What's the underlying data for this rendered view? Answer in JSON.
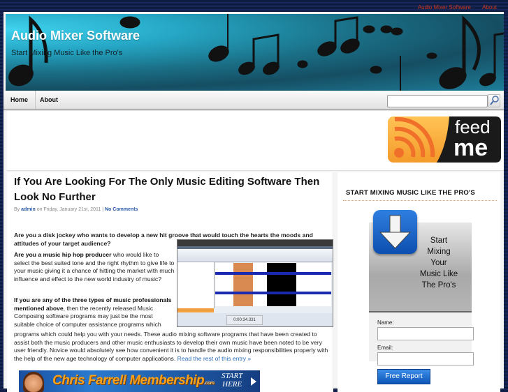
{
  "top_links": [
    "Audio Mixer Software",
    "About"
  ],
  "header": {
    "title": "Audio Mixer Software",
    "tagline": "Start Mixing Music Like the Pro's"
  },
  "nav": {
    "items": [
      "Home",
      "About"
    ],
    "search_value": "",
    "search_icon": "magnifier-icon"
  },
  "feed_badge": {
    "line1": "feed",
    "line2": "me",
    "icon": "rss-icon"
  },
  "post": {
    "title": "If You Are Looking For The Only Music Editing Software Then Look No Further",
    "meta_by": "By ",
    "author": "admin",
    "meta_on": " on Friday, January 21st, 2011 | ",
    "comments": "No Comments",
    "p1": "Are you  a disk jockey who wants to develop a new hit groove that would touch the hearts the moods and attitudes of your target audience?",
    "p2_bold": "Are you a music hip hop producer",
    "p2_rest": " who would like to select the best suited tone and the right rhythm to give life to your music giving it a chance of hitting the market with much influence and effect to the new world industry of music?",
    "p3_bold": " If you are any of the three types of music professionals mentioned above",
    "p3_rest": ", then the recently released Music Composing software programs may just be the most suitable choice of computer assistance programs which could help you with your needs. These audio mixing software programs that have been created to assist both the music producers and other music enthusiasts to develop their own music have been noted to be very user friendly. Novice would absolutely see how convenient it is to handle the audio mixing responsibilities properly with the help of the new age technology of computer applications.",
    "read_more": "Read the rest of this entry »",
    "screenshot_time": "0:00:34.331"
  },
  "banner": {
    "text": "Chris Farrell Membership",
    "com": ".com",
    "cta_line1": "START",
    "cta_line2": "HERE"
  },
  "sidebar": {
    "widget_title": "START MIXING MUSIC LIKE THE PRO'S",
    "optin_lines": [
      "Start",
      "Mixing",
      "Your",
      "Music Like",
      "The Pro's"
    ],
    "name_label": "Name:",
    "name_value": "",
    "email_label": "Email:",
    "email_value": "",
    "button": "Free Report"
  },
  "colors": {
    "accent_link": "#2a5aa8",
    "toplink": "#c8361e",
    "button_blue": "#1a6ad0",
    "feed_orange": "#f39a2a"
  }
}
